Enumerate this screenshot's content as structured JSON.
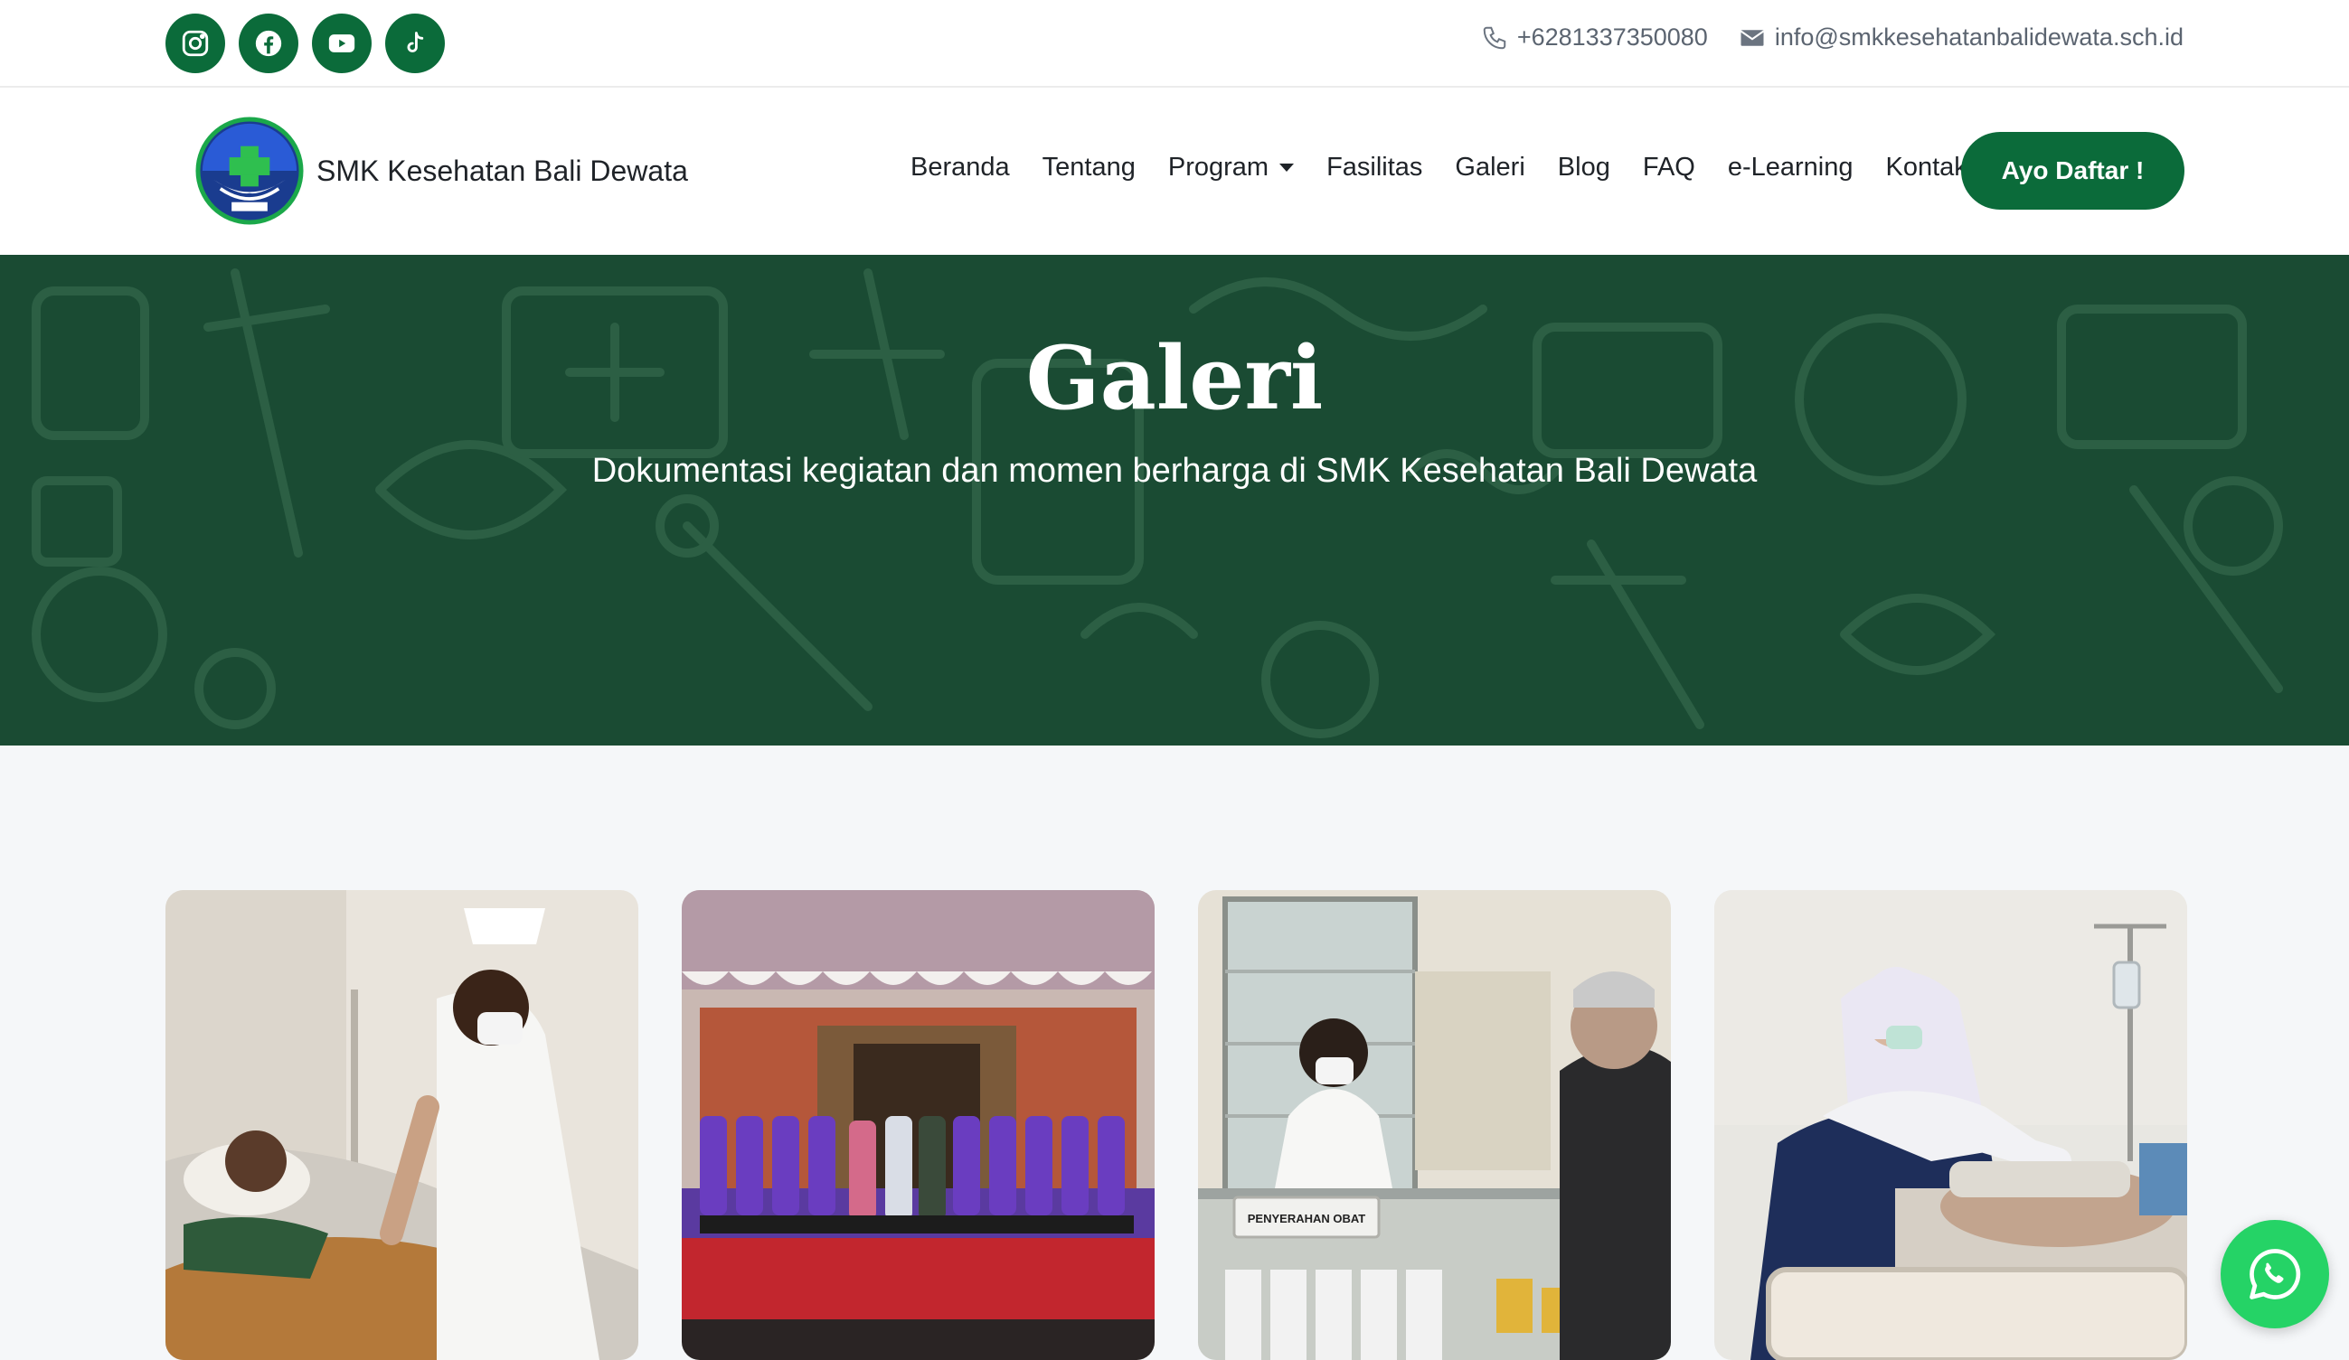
{
  "topbar": {
    "socials": [
      {
        "name": "instagram-icon"
      },
      {
        "name": "facebook-icon"
      },
      {
        "name": "youtube-icon"
      },
      {
        "name": "tiktok-icon"
      }
    ],
    "phone": "+6281337350080",
    "email": "info@smkkesehatanbalidewata.sch.id"
  },
  "nav": {
    "brand": "SMK Kesehatan Bali Dewata",
    "items": [
      "Beranda",
      "Tentang",
      "Program",
      "Fasilitas",
      "Galeri",
      "Blog",
      "FAQ",
      "e-Learning",
      "Kontak"
    ],
    "cta": "Ayo Daftar !"
  },
  "hero": {
    "title": "Galeri",
    "subtitle": "Dokumentasi kegiatan dan momen berharga di SMK Kesehatan Bali Dewata"
  },
  "gallery": [
    {
      "subject": "nurse-with-patient-photo"
    },
    {
      "subject": "group-photo"
    },
    {
      "subject": "pharmacy-photo",
      "sign": "PENYERAHAN OBAT"
    },
    {
      "subject": "nurse-bedside-photo"
    }
  ],
  "colors": {
    "brand_green": "#0b6b3a",
    "hero_bg": "#1a4b33",
    "whatsapp": "#25d366"
  }
}
